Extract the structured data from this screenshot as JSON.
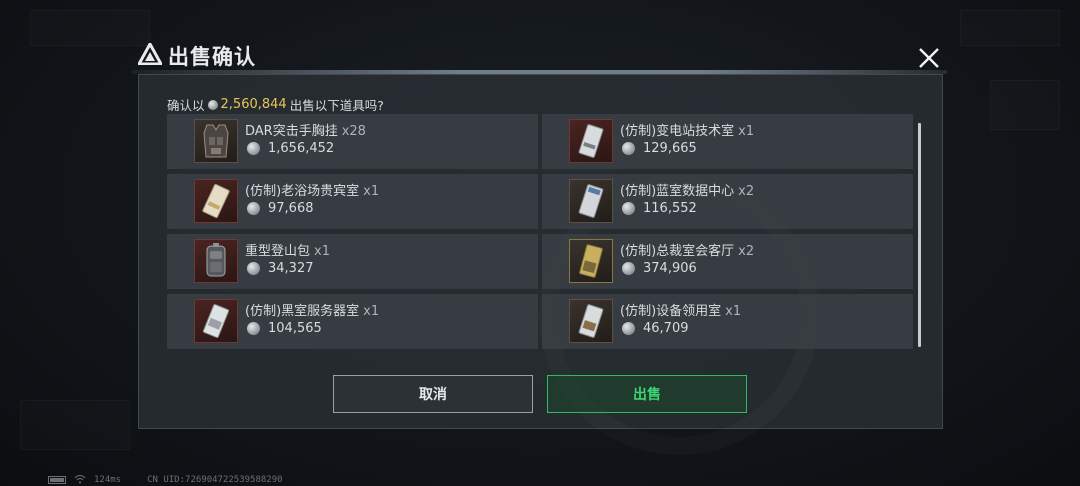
{
  "dialog": {
    "title": "出售确认",
    "logo_icon": "triangle-logo-icon",
    "close_icon": "close-icon"
  },
  "confirm": {
    "prefix": "确认以",
    "amount": "2,560,844",
    "suffix": "出售以下道具吗?"
  },
  "items": [
    {
      "name": "DAR突击手胸挂",
      "qty": "x28",
      "price": "1,656,452",
      "icon": "tactical-vest-icon"
    },
    {
      "name": "(仿制)变电站技术室",
      "qty": "x1",
      "price": "129,665",
      "icon": "keycard-icon"
    },
    {
      "name": "(仿制)老浴场贵宾室",
      "qty": "x1",
      "price": "97,668",
      "icon": "keycard-icon"
    },
    {
      "name": "(仿制)蓝室数据中心",
      "qty": "x2",
      "price": "116,552",
      "icon": "keycard-icon"
    },
    {
      "name": "重型登山包",
      "qty": "x1",
      "price": "34,327",
      "icon": "backpack-icon"
    },
    {
      "name": "(仿制)总裁室会客厅",
      "qty": "x2",
      "price": "374,906",
      "icon": "keycard-icon"
    },
    {
      "name": "(仿制)黑室服务器室",
      "qty": "x1",
      "price": "104,565",
      "icon": "keycard-icon"
    },
    {
      "name": "(仿制)设备领用室",
      "qty": "x1",
      "price": "46,709",
      "icon": "keycard-icon"
    }
  ],
  "buttons": {
    "cancel": "取消",
    "sell": "出售"
  },
  "status": {
    "ping": "124ms",
    "uid": "CN UID:7269047225395882​90"
  },
  "colors": {
    "accent_green": "#3dd472",
    "amount_gold": "#e8c45a",
    "item_frame_red": "#6c3a36"
  }
}
